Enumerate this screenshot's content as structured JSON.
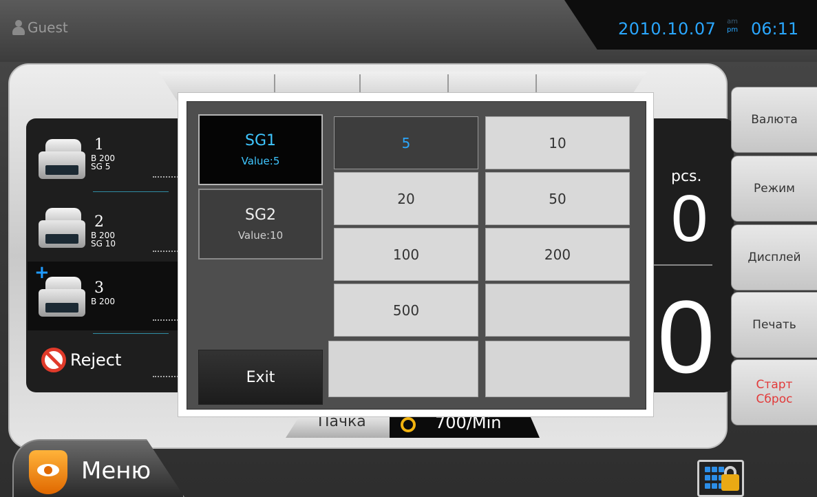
{
  "header": {
    "user": "Guest",
    "date": "2010.10.07",
    "am": "am",
    "pm": "pm",
    "time": "06:11"
  },
  "devices": [
    {
      "num": "1",
      "line1": "B 200",
      "line2": "SG 5"
    },
    {
      "num": "2",
      "line1": "B 200",
      "line2": "SG 10"
    },
    {
      "num": "3",
      "line1": "B 200",
      "line2": ""
    }
  ],
  "reject_label": "Reject",
  "readouts": {
    "pcs_label": "pcs.",
    "count1": "0",
    "count2": "0"
  },
  "status_strip": {
    "left": "Пачка",
    "right": "700/Min"
  },
  "side_menu": {
    "currency": "Валюта",
    "mode": "Режим",
    "display": "Дисплей",
    "print": "Печать",
    "start_line1": "Старт",
    "start_line2": "Сброс"
  },
  "menu_label": "Меню",
  "dialog": {
    "sg1": {
      "title": "SG1",
      "value": "Value:5"
    },
    "sg2": {
      "title": "SG2",
      "value": "Value:10"
    },
    "exit": "Exit",
    "values": [
      "5",
      "10",
      "20",
      "50",
      "100",
      "200",
      "500",
      "",
      "",
      ""
    ],
    "selected_value": "5"
  },
  "colors": {
    "accent_blue": "#2aa7ff",
    "selected_cyan": "#3fc6ff",
    "alert_red": "#e23a3a"
  }
}
